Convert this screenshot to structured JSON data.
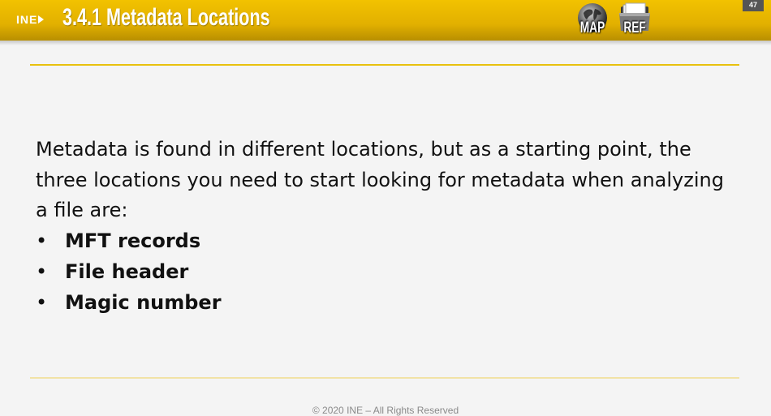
{
  "header": {
    "logo_text": "INE",
    "title": "3.4.1 Metadata Locations",
    "map_label": "MAP",
    "ref_label": "REF",
    "page_number": "47",
    "background_color": "#e2b000",
    "map_icon": "globe-icon",
    "ref_icon": "folder-icon"
  },
  "content": {
    "intro": "Metadata is found in different locations, but as a starting point, the three locations you need to start looking for metadata when analyzing a file are:",
    "bullet_char": "•",
    "bullets": [
      "MFT records",
      "File header",
      "Magic number"
    ]
  },
  "footer": {
    "copyright": "© 2020 INE – All Rights Reserved"
  }
}
